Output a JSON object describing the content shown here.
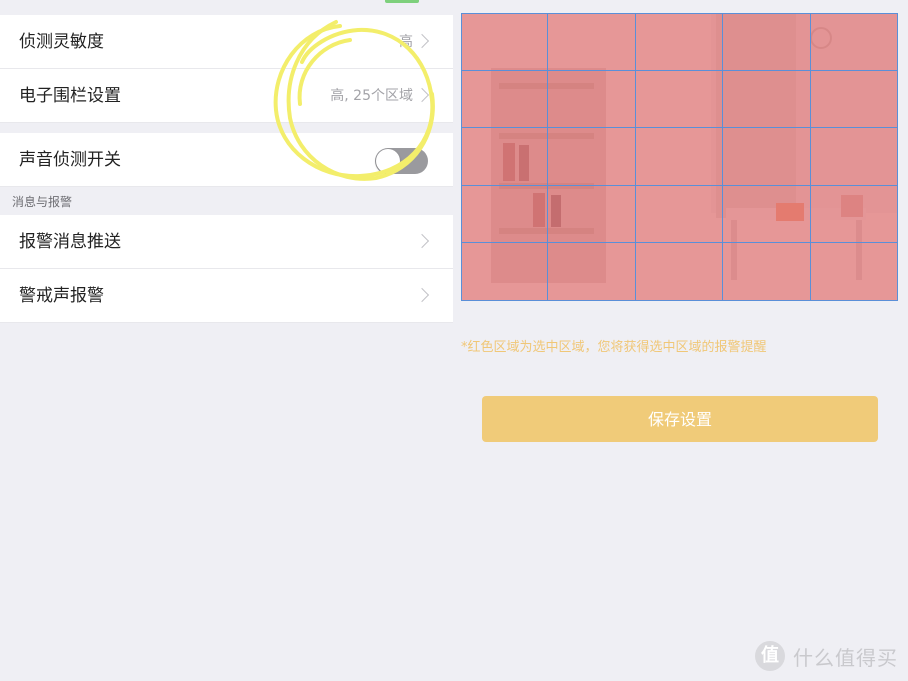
{
  "settings": {
    "sensitivity": {
      "label": "侦测灵敏度",
      "value": "高"
    },
    "fence": {
      "label": "电子围栏设置",
      "value": "高, 25个区域"
    },
    "sound": {
      "label": "声音侦测开关",
      "enabled": false
    },
    "section_header": "消息与报警",
    "alarm_push": {
      "label": "报警消息推送"
    },
    "siren": {
      "label": "警戒声报警"
    }
  },
  "zone": {
    "grid_rows": 5,
    "grid_cols": 5,
    "selected_count": 25,
    "selected_color": "#e06068",
    "grid_line_color": "#5a8fd8",
    "hint": "*红色区域为选中区域，您将获得选中区域的报警提醒",
    "save_label": "保存设置"
  },
  "watermark": {
    "logo": "值",
    "text": "什么值得买"
  },
  "colors": {
    "accent": "#f0cb79",
    "hint": "#f0c777",
    "annotation": "#f3ee6b",
    "toggle_off": "#9a9a9e"
  }
}
